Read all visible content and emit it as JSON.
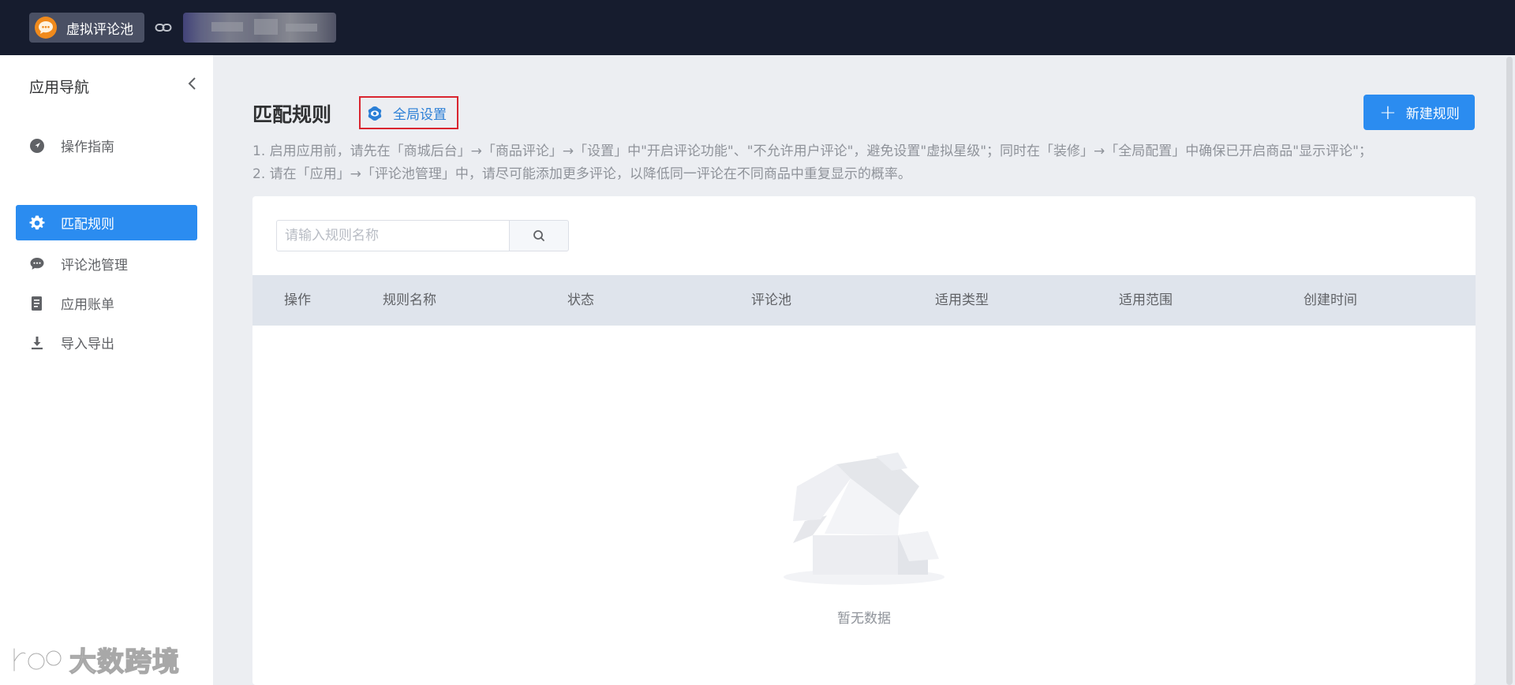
{
  "header": {
    "app_name": "虚拟评论池"
  },
  "sidebar": {
    "title": "应用导航",
    "items": [
      {
        "label": "操作指南",
        "icon": "navigation-arrow-icon",
        "active": false
      },
      {
        "label": "匹配规则",
        "icon": "gear-icon",
        "active": true
      },
      {
        "label": "评论池管理",
        "icon": "chat-bubble-icon",
        "active": false
      },
      {
        "label": "应用账单",
        "icon": "document-icon",
        "active": false
      },
      {
        "label": "导入导出",
        "icon": "download-icon",
        "active": false
      }
    ]
  },
  "main": {
    "title": "匹配规则",
    "global_settings_label": "全局设置",
    "new_rule_label": "新建规则",
    "tips": [
      "1. 启用应用前，请先在「商城后台」→「商品评论」→「设置」中\"开启评论功能\"、\"不允许用户评论\"，避免设置\"虚拟星级\"；同时在「装修」→「全局配置」中确保已开启商品\"显示评论\"；",
      "2. 请在「应用」→「评论池管理」中，请尽可能添加更多评论，以降低同一评论在不同商品中重复显示的概率。"
    ],
    "search": {
      "placeholder": "请输入规则名称",
      "value": ""
    },
    "table": {
      "columns": [
        "操作",
        "规则名称",
        "状态",
        "评论池",
        "适用类型",
        "适用范围",
        "创建时间"
      ],
      "rows": []
    },
    "empty_text": "暂无数据"
  },
  "watermark": {
    "text": "大数跨境"
  },
  "colors": {
    "topbar": "#161c2e",
    "primary": "#2b8cf0",
    "highlight_border": "#d9252f",
    "link": "#2b7fd6"
  }
}
